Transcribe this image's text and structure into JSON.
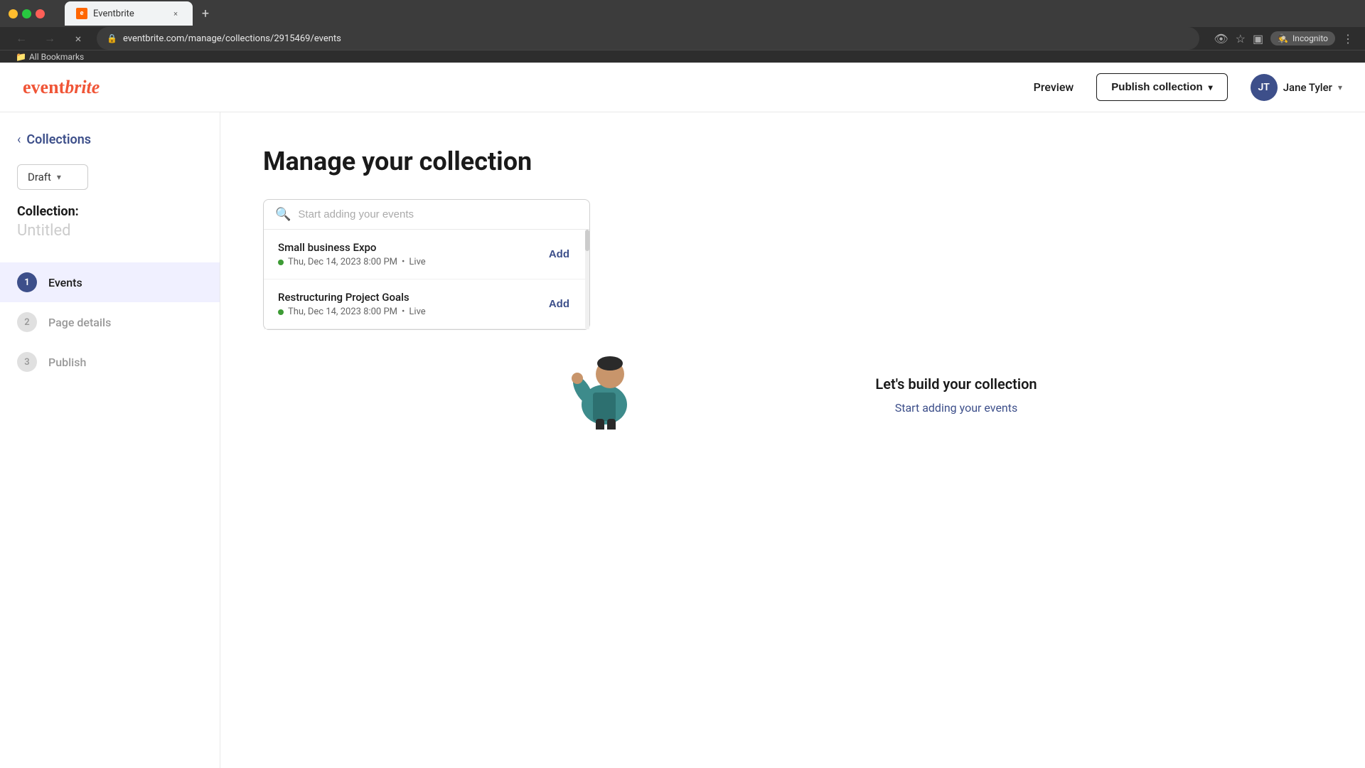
{
  "browser": {
    "tab_favicon": "E",
    "tab_title": "Eventbrite",
    "tab_close": "×",
    "new_tab": "+",
    "nav_back": "←",
    "nav_forward": "→",
    "nav_reload": "×",
    "address": "eventbrite.com/manage/collections/2915469/events",
    "incognito_label": "Incognito",
    "bookmarks_label": "All Bookmarks"
  },
  "header": {
    "logo": "eventbrite",
    "preview_label": "Preview",
    "publish_label": "Publish collection",
    "user_initials": "JT",
    "user_name": "Jane Tyler"
  },
  "sidebar": {
    "back_label": "Collections",
    "draft_label": "Draft",
    "collection_prefix": "Collection:",
    "collection_name": "Untitled",
    "nav_items": [
      {
        "number": "1",
        "label": "Events",
        "active": true
      },
      {
        "number": "2",
        "label": "Page details",
        "active": false
      },
      {
        "number": "3",
        "label": "Publish",
        "active": false
      }
    ]
  },
  "content": {
    "page_title": "Manage your collection",
    "search_placeholder": "Start adding your events",
    "events": [
      {
        "title": "Small business Expo",
        "date": "Thu, Dec 14, 2023 8:00 PM",
        "status": "Live",
        "add_label": "Add"
      },
      {
        "title": "Restructuring Project Goals",
        "date": "Thu, Dec 14, 2023 8:00 PM",
        "status": "Live",
        "add_label": "Add"
      }
    ],
    "empty_state": {
      "title": "Let's build your collection",
      "link_label": "Start adding your events"
    }
  }
}
